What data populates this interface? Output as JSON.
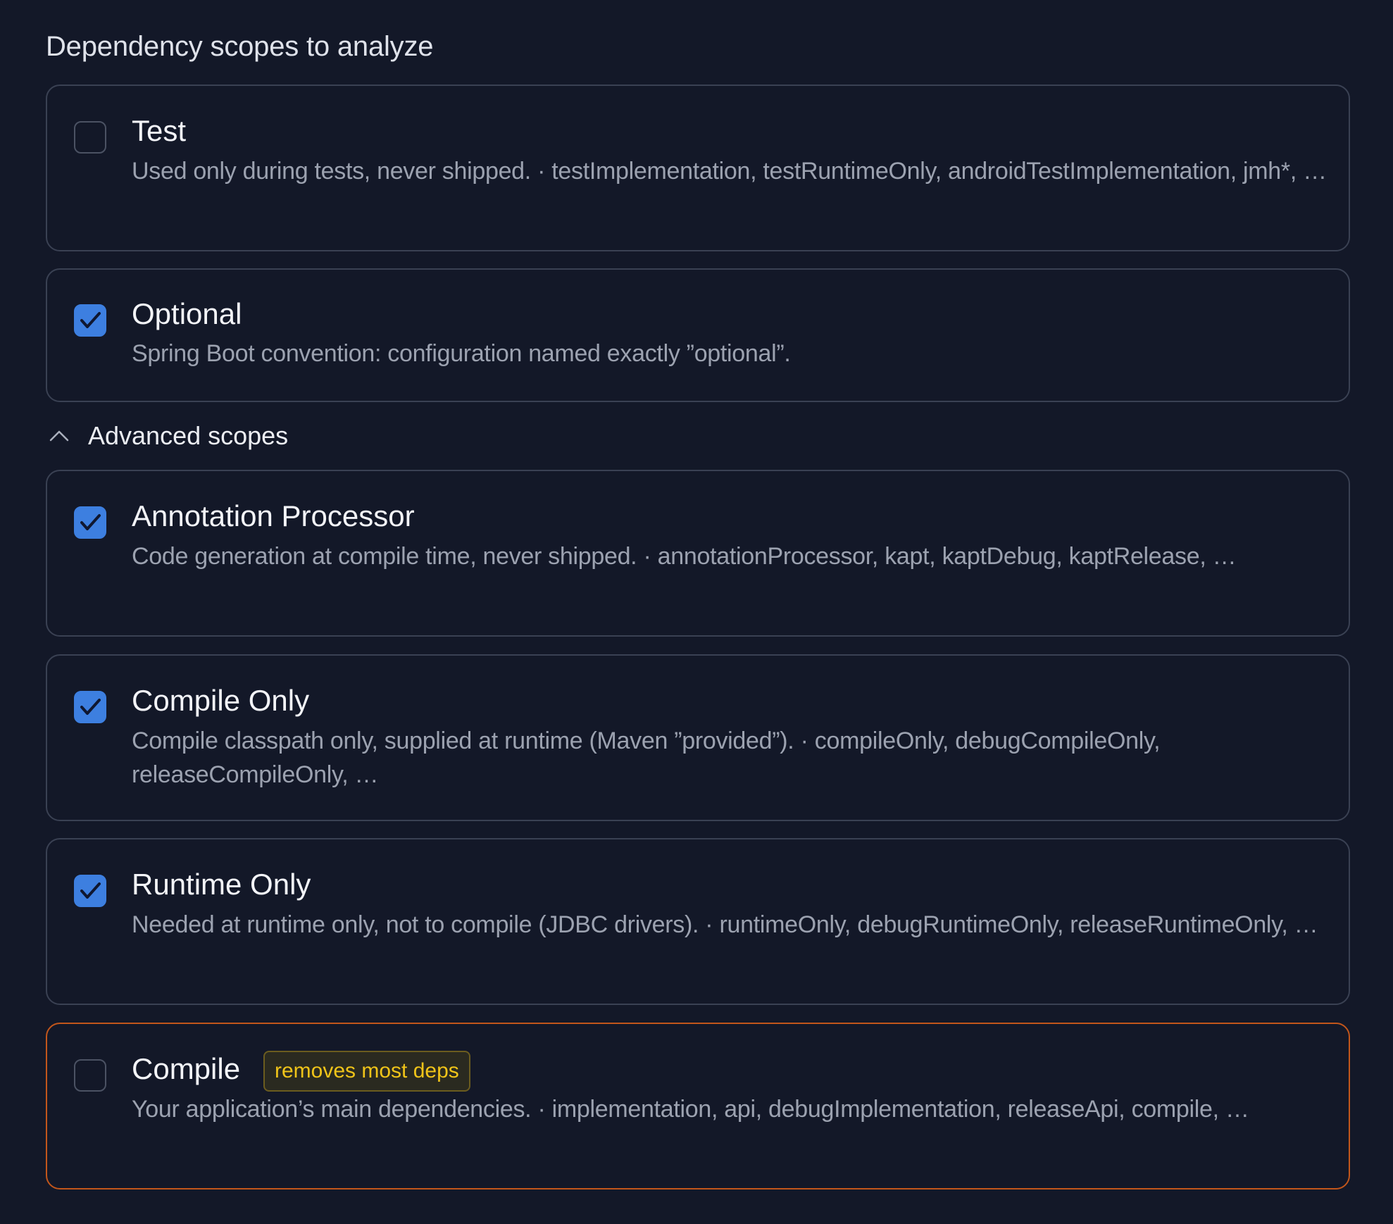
{
  "section_title": "Dependency scopes to analyze",
  "advanced_toggle": {
    "label": "Advanced scopes",
    "icon": "chevron-up-icon",
    "expanded": true
  },
  "scopes": [
    {
      "title": "Test",
      "checked": false,
      "description": "Used only during tests, never shipped. · testImplementation, testRuntimeOnly, androidTestImplementation, jmh*, …"
    },
    {
      "title": "Optional",
      "checked": true,
      "description": "Spring Boot convention: configuration named exactly ”optional”."
    },
    {
      "title": "Annotation Processor",
      "checked": true,
      "description": "Code generation at compile time, never shipped. · annotationProcessor, kapt, kaptDebug, kaptRelease, …"
    },
    {
      "title": "Compile Only",
      "checked": true,
      "description": "Compile classpath only, supplied at runtime (Maven ”provided”). · compileOnly, debugCompileOnly, releaseCompileOnly, …"
    },
    {
      "title": "Runtime Only",
      "checked": true,
      "description": "Needed at runtime only, not to compile (JDBC drivers). · runtimeOnly, debugRuntimeOnly, releaseRuntimeOnly, …"
    },
    {
      "title": "Compile",
      "checked": false,
      "badge": "removes most deps",
      "description": "Your application’s main dependencies. · implementation, api, debugImplementation, releaseApi, compile, …"
    }
  ],
  "colors": {
    "background": "#131828",
    "card_border": "#3a4153",
    "warning_border": "#c2561b",
    "checkbox_checked": "#3d7fe0",
    "badge_text": "#f0c419",
    "badge_border": "#6b5c1f"
  }
}
